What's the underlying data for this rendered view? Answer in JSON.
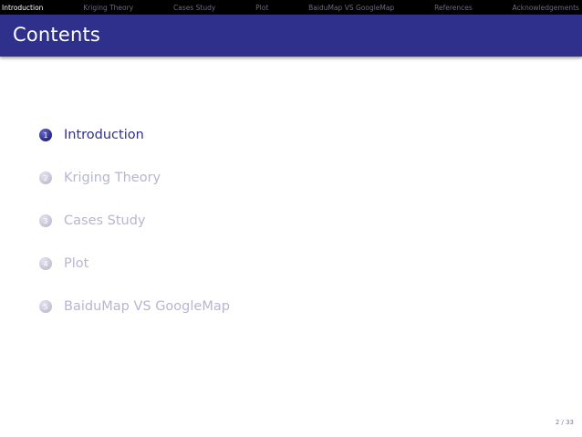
{
  "nav": {
    "items": [
      {
        "label": "Introduction",
        "active": true
      },
      {
        "label": "Kriging Theory",
        "active": false
      },
      {
        "label": "Cases Study",
        "active": false
      },
      {
        "label": "Plot",
        "active": false
      },
      {
        "label": "BaiduMap VS GoogleMap",
        "active": false
      },
      {
        "label": "References",
        "active": false
      },
      {
        "label": "Acknowledgements",
        "active": false
      }
    ]
  },
  "frame": {
    "title": "Contents"
  },
  "toc": {
    "items": [
      {
        "number": "1",
        "label": "Introduction",
        "active": true
      },
      {
        "number": "2",
        "label": "Kriging Theory",
        "active": false
      },
      {
        "number": "3",
        "label": "Cases Study",
        "active": false
      },
      {
        "number": "4",
        "label": "Plot",
        "active": false
      },
      {
        "number": "5",
        "label": "BaiduMap VS GoogleMap",
        "active": false
      }
    ]
  },
  "footer": {
    "page": "2 / 33"
  },
  "colors": {
    "accent": "#2f2f8c",
    "navbar_bg": "#000000",
    "dim_text": "#b6b6cf"
  }
}
